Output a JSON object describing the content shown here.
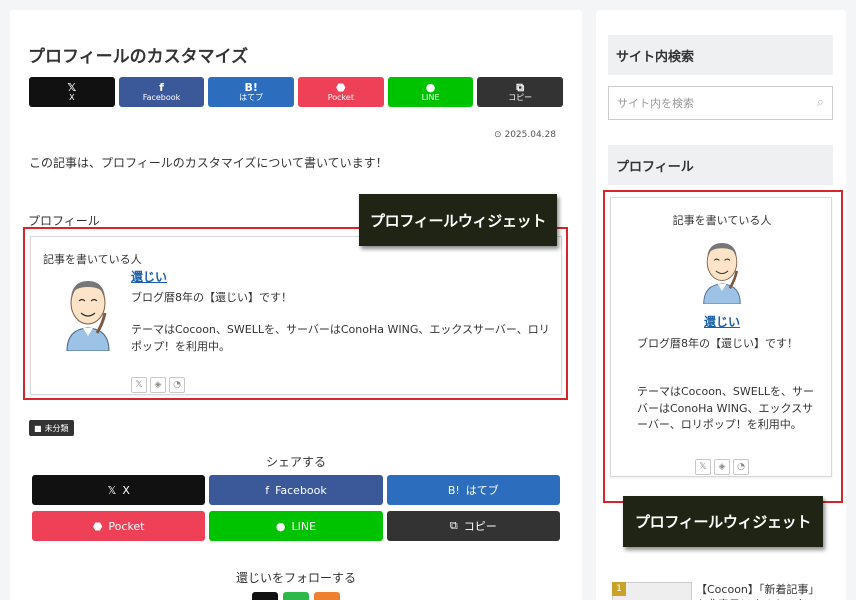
{
  "article": {
    "title": "プロフィールのカスタマイズ",
    "date": "2025.04.28",
    "intro": "この記事は、プロフィールのカスタマイズについて書いています！",
    "profile_heading": "プロフィール",
    "category": "未分類"
  },
  "share_top": [
    {
      "label": "X",
      "icon": "𝕏",
      "color": "#111111"
    },
    {
      "label": "Facebook",
      "icon": "f",
      "color": "#3b5998"
    },
    {
      "label": "はてブ",
      "icon": "B!",
      "color": "#2c6ebd"
    },
    {
      "label": "Pocket",
      "icon": "⬣",
      "color": "#ee4056"
    },
    {
      "label": "LINE",
      "icon": "●",
      "color": "#00c300"
    },
    {
      "label": "コピー",
      "icon": "⧉",
      "color": "#333333"
    }
  ],
  "callouts": {
    "main": "プロフィールウィジェット",
    "side": "プロフィールウィジェット"
  },
  "author_card": {
    "label": "記事を書いている人",
    "name": "還じい",
    "bio1": "ブログ暦8年の【還じい】です！",
    "bio2": "テーマはCocoon、SWELLを、サーバーはConoHa WING、エックスサーバー、ロリポップ！を利用中。",
    "icons": [
      "x-icon",
      "feedly-icon",
      "rss-icon"
    ]
  },
  "share_bottom": {
    "heading": "シェアする",
    "buttons": [
      {
        "label": "X",
        "icon": "𝕏",
        "color": "#111111"
      },
      {
        "label": "Facebook",
        "icon": "f",
        "color": "#3b5998"
      },
      {
        "label": "はてブ",
        "icon": "B!",
        "color": "#2c6ebd"
      },
      {
        "label": "Pocket",
        "icon": "⬣",
        "color": "#ee4056"
      },
      {
        "label": "LINE",
        "icon": "●",
        "color": "#00c300"
      },
      {
        "label": "コピー",
        "icon": "⧉",
        "color": "#333333"
      }
    ]
  },
  "follow": {
    "heading": "還じいをフォローする",
    "colors": [
      "#111111",
      "#2eb84b",
      "#ee802f"
    ]
  },
  "sidebar": {
    "search_heading": "サイト内検索",
    "search_placeholder": "サイト内を検索",
    "profile_heading": "プロフィール",
    "profile_label": "記事を書いている人",
    "profile_name": "還じい",
    "profile_bio1": "ブログ暦8年の【還じい】です！",
    "profile_bio2": "テーマはCocoon、SWELLを、サーバーはConoHa WING、エックスサーバー、ロリポップ！を利用中。",
    "new_post_number": "1",
    "new_post_title": "【Cocoon】「新着記事」を非表示にするカスタマイズ"
  }
}
